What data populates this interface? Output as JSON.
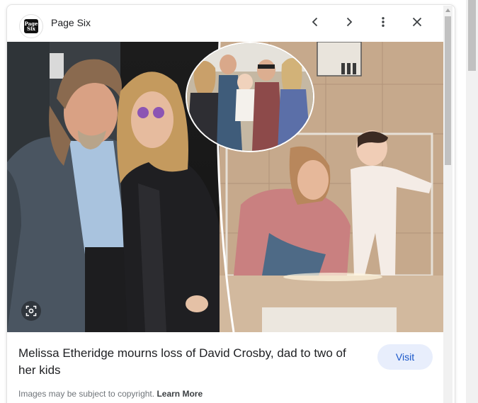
{
  "panel": {
    "source": {
      "name": "Page Six",
      "logo_text_line1": "Page",
      "logo_text_line2": "Six"
    },
    "header_icons": [
      "chevron-left-icon",
      "chevron-right-icon",
      "more-vert-icon",
      "close-icon"
    ],
    "image": {
      "lens_icon": "lens-icon"
    },
    "caption": {
      "title": "Melissa Etheridge mourns loss of David Crosby, dad to two of her kids",
      "visit_label": "Visit",
      "copyright_text": "Images may be subject to copyright.",
      "learn_more_label": "Learn More"
    }
  },
  "colors": {
    "visit_bg": "#e8eefc",
    "visit_text": "#1a57c9",
    "title_text": "#202124",
    "muted_text": "#70757a"
  }
}
